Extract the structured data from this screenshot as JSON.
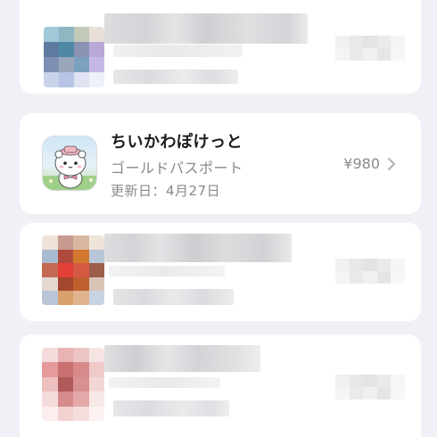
{
  "subscription": {
    "app_name": "ちいかわぽけっと",
    "plan": "ゴールドパスポート",
    "updated_label": "更新日：4月27日",
    "price": "¥980"
  },
  "icons": {
    "app_icon": "chiikawa-character-app-icon",
    "chevron": "chevron-right-icon"
  },
  "colors": {
    "background": "#f1f0f6",
    "card": "#ffffff",
    "primary_text": "#1c1c1e",
    "secondary_text": "#8a8a8e"
  }
}
